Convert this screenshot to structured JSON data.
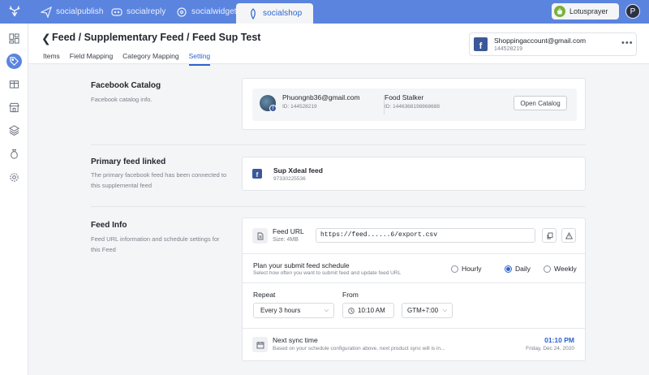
{
  "app": {
    "tabs": [
      {
        "label": "socialpublish",
        "icon": "send-icon"
      },
      {
        "label": "socialreply",
        "icon": "chat-icon"
      },
      {
        "label": "socialwidget",
        "icon": "widget-icon"
      },
      {
        "label": "socialshop",
        "icon": "shop-icon",
        "active": true
      }
    ],
    "shop_name": "Lotusprayer",
    "user_initial": "P",
    "accent_color": "#5b84df"
  },
  "sidebar": {
    "items": [
      {
        "icon": "dashboard-icon"
      },
      {
        "icon": "tag-icon",
        "active": true
      },
      {
        "icon": "box-icon"
      },
      {
        "icon": "store-icon"
      },
      {
        "icon": "layers-icon"
      },
      {
        "icon": "money-bag-icon"
      },
      {
        "icon": "settings-icon"
      }
    ]
  },
  "header": {
    "title": "Feed / Supplementary Feed / Feed Sup Test",
    "tabs": [
      "Items",
      "Field Mapping",
      "Category Mapping",
      "Setting"
    ],
    "active_tab": "Setting",
    "account": {
      "email": "Shoppingaccount@gmail.com",
      "id": "144528219"
    }
  },
  "facebook_catalog": {
    "title": "Facebook Catalog",
    "description": "Facebook catalog info.",
    "profile": {
      "name": "Phuongnb36@gmail.com",
      "id": "ID: 144528219"
    },
    "catalog": {
      "name": "Food Stalker",
      "id": "ID: 1446368198868688"
    },
    "open_button": "Open Catalog"
  },
  "primary_feed": {
    "title": "Primary feed linked",
    "description": "The primary facebook feed has been connected to this supplemental feed",
    "feed_name": "Sup Xdeal feed",
    "feed_id": "97330225536"
  },
  "feed_info": {
    "title": "Feed Info",
    "description": "Feed URL information and schedule settings for this Feed",
    "url_label": "Feed URL",
    "size": "Size: 4MB",
    "url": "https://feed......6/export.csv",
    "schedule_title": "Plan your submit feed schedule",
    "schedule_desc": "Select how often you want to submit feed and update feed URL",
    "options": [
      "Hourly",
      "Daily",
      "Weekly"
    ],
    "selected": "Daily",
    "repeat_label": "Repeat",
    "repeat_value": "Every 3 hours",
    "from_label": "From",
    "from_time": "10:10 AM",
    "timezone": "GTM+7:00",
    "next_sync_label": "Next sync time",
    "next_sync_desc": "Based on your schedule configuration above, next product sync will is in...",
    "next_sync_time": "01:10 PM",
    "next_sync_date": "Friday, Dec 24, 2020"
  }
}
